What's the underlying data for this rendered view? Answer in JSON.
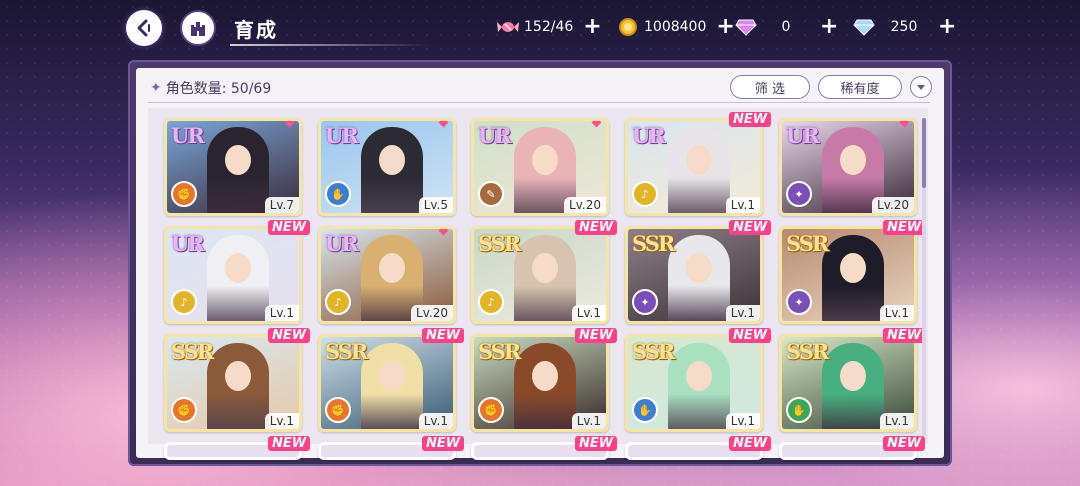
{
  "header": {
    "title": "育成",
    "resources": [
      {
        "icon": "candy-icon",
        "value": "152/46"
      },
      {
        "icon": "gold-coin-icon",
        "value": "1008400"
      },
      {
        "icon": "pink-diamond-icon",
        "value": "0"
      },
      {
        "icon": "blue-diamond-icon",
        "value": "250"
      }
    ],
    "plus_label": "+"
  },
  "panel": {
    "count_label": "角色数量: 50/69",
    "filter_label": "筛 选",
    "rarity_label": "稀有度"
  },
  "cards": [
    {
      "rarity": "UR",
      "level": "Lv.7",
      "new": false,
      "gem": true,
      "element": "fire",
      "elem_color": "#e8732a",
      "bg": [
        "#7aa6d8",
        "#3b2b3a"
      ],
      "hair": "#2a2430"
    },
    {
      "rarity": "UR",
      "level": "Lv.5",
      "new": false,
      "gem": true,
      "element": "water",
      "elem_color": "#3a7fd6",
      "bg": [
        "#9ac6ee",
        "#cfe3f4"
      ],
      "hair": "#2c2a33"
    },
    {
      "rarity": "UR",
      "level": "Lv.20",
      "new": false,
      "gem": true,
      "element": "earth",
      "elem_color": "#a66a3c",
      "bg": [
        "#cfe0c8",
        "#f1e6d8"
      ],
      "hair": "#e9b3b8"
    },
    {
      "rarity": "UR",
      "level": "Lv.1",
      "new": true,
      "gem": false,
      "element": "light",
      "elem_color": "#e0b52a",
      "bg": [
        "#d9e6f0",
        "#f4ead6"
      ],
      "hair": "#e8e4ea"
    },
    {
      "rarity": "UR",
      "level": "Lv.20",
      "new": false,
      "gem": true,
      "element": "dark",
      "elem_color": "#7a4fb8",
      "bg": [
        "#e8d8ea",
        "#3a2838"
      ],
      "hair": "#c77aa8"
    },
    {
      "rarity": "UR",
      "level": "Lv.1",
      "new": true,
      "gem": false,
      "element": "light",
      "elem_color": "#e0b52a",
      "bg": [
        "#dde6f2",
        "#e8e0ee"
      ],
      "hair": "#f0f0f4"
    },
    {
      "rarity": "UR",
      "level": "Lv.20",
      "new": false,
      "gem": true,
      "element": "light",
      "elem_color": "#e0b52a",
      "bg": [
        "#d8e4ec",
        "#8a5a3a"
      ],
      "hair": "#d9b070"
    },
    {
      "rarity": "SSR",
      "level": "Lv.1",
      "new": true,
      "gem": false,
      "element": "light",
      "elem_color": "#e0b52a",
      "bg": [
        "#c8d8c8",
        "#eeeae0"
      ],
      "hair": "#d8c4ae"
    },
    {
      "rarity": "SSR",
      "level": "Lv.1",
      "new": true,
      "gem": false,
      "element": "dark",
      "elem_color": "#7a4fb8",
      "bg": [
        "#8f7f8a",
        "#3a3438"
      ],
      "hair": "#e8e8ec"
    },
    {
      "rarity": "SSR",
      "level": "Lv.1",
      "new": true,
      "gem": false,
      "element": "dark",
      "elem_color": "#7a4fb8",
      "bg": [
        "#b88a70",
        "#e8d4c0"
      ],
      "hair": "#1f1c2a"
    },
    {
      "rarity": "SSR",
      "level": "Lv.1",
      "new": true,
      "gem": false,
      "element": "fire",
      "elem_color": "#e8732a",
      "bg": [
        "#d8e8f0",
        "#e6c8a8"
      ],
      "hair": "#8a5a3a"
    },
    {
      "rarity": "SSR",
      "level": "Lv.1",
      "new": true,
      "gem": false,
      "element": "fire",
      "elem_color": "#e8732a",
      "bg": [
        "#cfe0e8",
        "#3a5a78"
      ],
      "hair": "#f0e0a8"
    },
    {
      "rarity": "SSR",
      "level": "Lv.1",
      "new": true,
      "gem": false,
      "element": "fire",
      "elem_color": "#e8732a",
      "bg": [
        "#c8dcc0",
        "#3a2a2a"
      ],
      "hair": "#8a4a2a"
    },
    {
      "rarity": "SSR",
      "level": "Lv.1",
      "new": true,
      "gem": false,
      "element": "water",
      "elem_color": "#3a7fd6",
      "bg": [
        "#d8e8d0",
        "#cfe8e0"
      ],
      "hair": "#a8e0c0"
    },
    {
      "rarity": "SSR",
      "level": "Lv.1",
      "new": true,
      "gem": false,
      "element": "wind",
      "elem_color": "#3aa65a",
      "bg": [
        "#d8e8c8",
        "#3a4a3a"
      ],
      "hair": "#48b080"
    },
    {
      "rarity": "",
      "level": "",
      "new": true,
      "gem": false,
      "element": "",
      "elem_color": "#c0b0d0",
      "bg": [
        "#e8e0ee",
        "#e8e0ee"
      ],
      "hair": "#e8e0ee"
    },
    {
      "rarity": "",
      "level": "",
      "new": true,
      "gem": false,
      "element": "",
      "elem_color": "#c0b0d0",
      "bg": [
        "#e8e0ee",
        "#e8e0ee"
      ],
      "hair": "#e8e0ee"
    },
    {
      "rarity": "",
      "level": "",
      "new": true,
      "gem": false,
      "element": "",
      "elem_color": "#c0b0d0",
      "bg": [
        "#e8e0ee",
        "#e8e0ee"
      ],
      "hair": "#e8e0ee"
    },
    {
      "rarity": "",
      "level": "",
      "new": true,
      "gem": false,
      "element": "",
      "elem_color": "#c0b0d0",
      "bg": [
        "#e8e0ee",
        "#e8e0ee"
      ],
      "hair": "#e8e0ee"
    },
    {
      "rarity": "",
      "level": "",
      "new": true,
      "gem": false,
      "element": "",
      "elem_color": "#c0b0d0",
      "bg": [
        "#e8e0ee",
        "#e8e0ee"
      ],
      "hair": "#e8e0ee"
    }
  ],
  "new_label": "NEW"
}
